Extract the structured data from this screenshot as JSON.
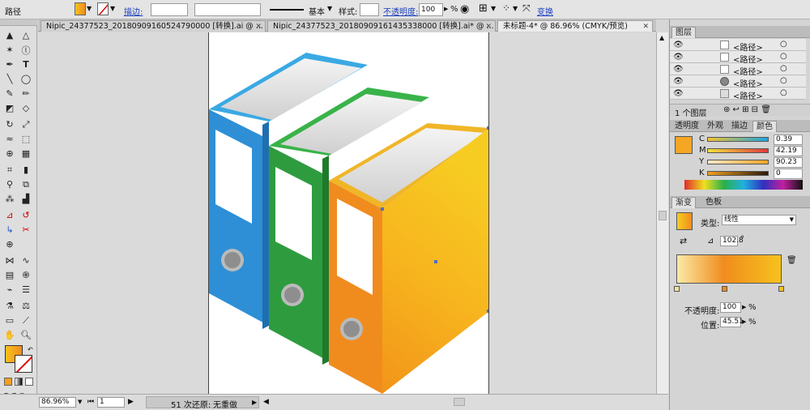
{
  "control_bar": {
    "selection_type": "路径",
    "stroke_label": "描边:",
    "basic_label": "基本",
    "style_label": "样式:",
    "opacity_label": "不透明度:",
    "opacity_value": "100",
    "opacity_unit": "%",
    "transform_label": "变换"
  },
  "doc_tabs": [
    {
      "label": "Nipic_24377523_20180909160524790000 [转换].ai @ ..."
    },
    {
      "label": "Nipic_24377523_20180909161435338000 [转换].ai* @ ..."
    },
    {
      "label": "未标题-4* @ 86.96% (CMYK/预览)"
    }
  ],
  "layers_panel": {
    "tab": "图层",
    "rows": [
      {
        "label": "<路径>"
      },
      {
        "label": "<路径>"
      },
      {
        "label": "<路径>"
      },
      {
        "label": "<路径>"
      },
      {
        "label": "<路径>"
      }
    ],
    "footer_count": "1 个图层"
  },
  "color_panel": {
    "tabs": [
      "透明度",
      "外观",
      "描边",
      "颜色"
    ],
    "channels": [
      {
        "name": "C",
        "value": "0.39"
      },
      {
        "name": "M",
        "value": "42.19"
      },
      {
        "name": "Y",
        "value": "90.23"
      },
      {
        "name": "K",
        "value": "0"
      }
    ],
    "swatch": "#f5a623"
  },
  "gradient_panel": {
    "tabs": [
      "渐变",
      "色板"
    ],
    "type_label": "类型:",
    "type_value": "线性",
    "angle_value": "102.8",
    "angle_unit": "°",
    "opacity_label": "不透明度:",
    "opacity_value": "100",
    "location_label": "位置:",
    "location_value": "45.51",
    "percent": "%"
  },
  "status_bar": {
    "zoom": "86.96%",
    "page": "1",
    "history": "51 次还原:",
    "redo": "无重做"
  },
  "colors": {
    "blue": "#2e8fd6",
    "green": "#2ea043",
    "orange": "#f08c1e",
    "yellow": "#f7c21d"
  }
}
